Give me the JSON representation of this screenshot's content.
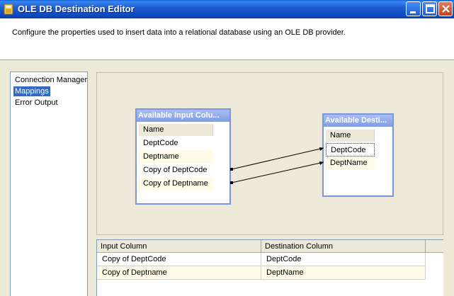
{
  "window": {
    "title": "OLE DB Destination Editor",
    "app_icon": "ssis-package-icon",
    "controls": [
      "minimize-icon",
      "maximize-icon",
      "close-icon"
    ]
  },
  "header": {
    "description": "Configure the properties used to insert data into a relational database using an OLE DB provider."
  },
  "nav": {
    "items": [
      {
        "label": "Connection Manager",
        "selected": false
      },
      {
        "label": "Mappings",
        "selected": true
      },
      {
        "label": "Error Output",
        "selected": false
      }
    ]
  },
  "input_table": {
    "title": "Available Input Colu...",
    "column_header": "Name",
    "rows": [
      "DeptCode",
      "Deptname",
      "Copy of DeptCode",
      "Copy of Deptname"
    ]
  },
  "dest_table": {
    "title": "Available Desti...",
    "column_header": "Name",
    "rows": [
      "DeptCode",
      "DeptName"
    ],
    "selected_row": "DeptCode"
  },
  "colors": {
    "title_bar": "#0c48c0",
    "box_border": "#7a96df",
    "selection": "#316ac5",
    "alt_row": "#fffbe8"
  },
  "grid": {
    "columns": [
      "Input Column",
      "Destination Column"
    ],
    "rows": [
      {
        "input": "Copy of DeptCode",
        "destination": "DeptCode"
      },
      {
        "input": "Copy of Deptname",
        "destination": "DeptName"
      }
    ]
  }
}
